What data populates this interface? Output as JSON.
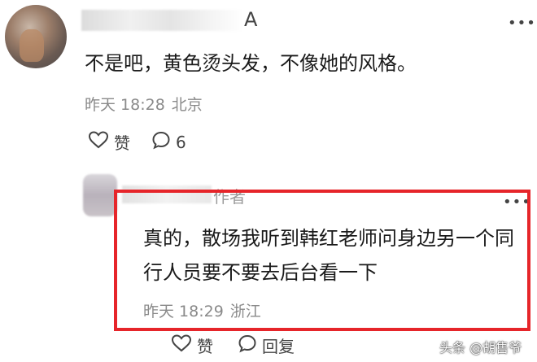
{
  "comment": {
    "username_suffix": "A",
    "text": "不是吧，黄色烫头发，不像她的风格。",
    "time": "昨天 18:28",
    "location": "北京",
    "like_label": "赞",
    "reply_count": "6"
  },
  "reply": {
    "username_suffix": "作者",
    "text": "真的，散场我听到韩红老师问身边另一个同行人员要不要去后台看一下",
    "time": "昨天 18:29",
    "location": "浙江",
    "like_label": "赞",
    "reply_label": "回复"
  },
  "watermark": "头条 @胡售爷",
  "colors": {
    "highlight_border": "#e6252a",
    "meta_text": "#8a8a8a",
    "body_text": "#1a1a1a"
  }
}
